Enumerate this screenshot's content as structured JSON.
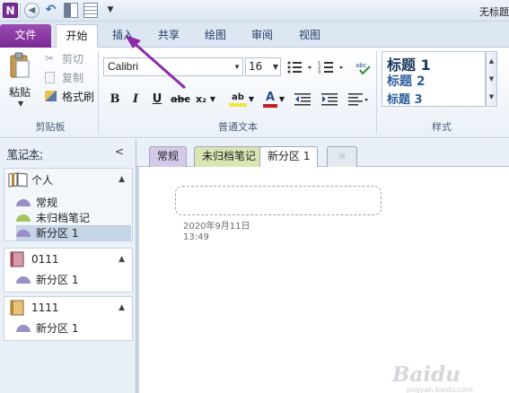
{
  "window": {
    "title": "无标题"
  },
  "quick_access": {
    "app_icon_letter": "N"
  },
  "ribbon_tabs": [
    {
      "label": "文件"
    },
    {
      "label": "开始"
    },
    {
      "label": "插入"
    },
    {
      "label": "共享"
    },
    {
      "label": "绘图"
    },
    {
      "label": "审阅"
    },
    {
      "label": "视图"
    }
  ],
  "clipboard": {
    "paste_label": "粘贴",
    "cut_label": "剪切",
    "copy_label": "复制",
    "format_painter_label": "格式刷",
    "group_label": "剪贴板"
  },
  "basic_text": {
    "font_name": "Calibri",
    "font_size": "16",
    "bold": "B",
    "italic": "I",
    "underline": "U",
    "strike": "abc",
    "subscript": "x₂",
    "font_color_letter": "A",
    "highlight_letter": "ab",
    "group_label": "普通文本"
  },
  "styles": {
    "items": [
      "标题 1",
      "标题 2",
      "标题 3"
    ],
    "group_label": "样式"
  },
  "sidebar": {
    "header": "笔记本:",
    "notebooks": [
      {
        "name": "个人",
        "sections": [
          {
            "name": "常规",
            "color": "#9b8fc7"
          },
          {
            "name": "未归档笔记",
            "color": "#a7c35e"
          },
          {
            "name": "新分区 1",
            "color": "#9b8fc7"
          }
        ]
      },
      {
        "name": "0111",
        "sections": [
          {
            "name": "新分区 1",
            "color": "#9b8fc7"
          }
        ]
      },
      {
        "name": "1111",
        "sections": [
          {
            "name": "新分区 1",
            "color": "#9b8fc7"
          }
        ]
      }
    ]
  },
  "section_tabs": [
    {
      "label": "常规"
    },
    {
      "label": "未归档笔记"
    },
    {
      "label": "新分区 1"
    },
    {
      "label": "☼"
    }
  ],
  "page": {
    "date": "2020年9月11日",
    "time": "13:49"
  },
  "watermark": {
    "text": "Baidu",
    "sub": "jingyan.baidu.com"
  },
  "colors": {
    "file_tab": "#7b2a94",
    "annotation_arrow": "#8a2aa8"
  }
}
